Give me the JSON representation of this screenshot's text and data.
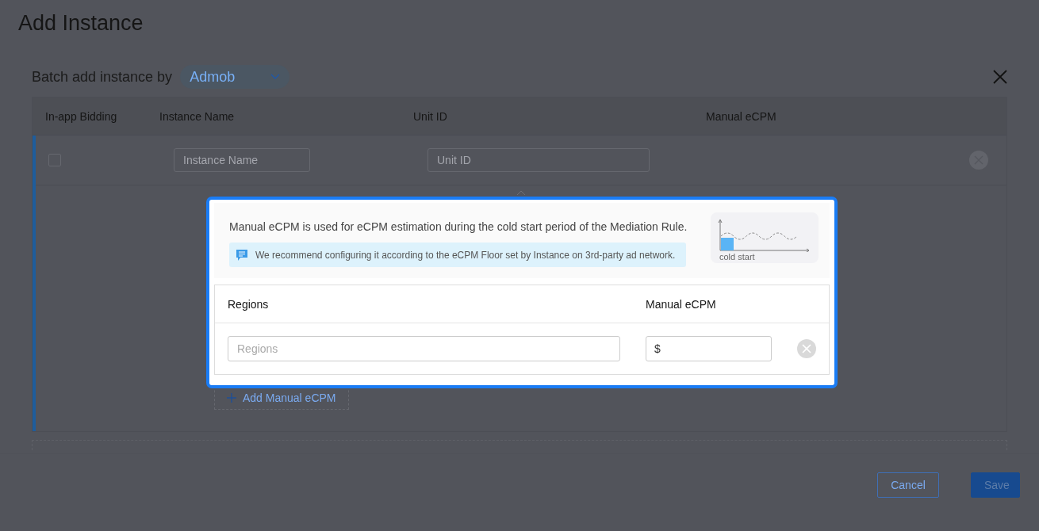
{
  "page": {
    "title": "Add Instance"
  },
  "batch": {
    "label": "Batch add instance by",
    "network": "Admob"
  },
  "table": {
    "columns": [
      "In-app Bidding",
      "Instance Name",
      "Unit ID",
      "Manual eCPM"
    ],
    "rows": [
      {
        "bidding_checked": false,
        "instance_name": {
          "placeholder": "Instance Name"
        },
        "unit_id": {
          "placeholder": "Unit ID"
        }
      }
    ]
  },
  "add_button": "Add Manual eCPM",
  "popover": {
    "description": "Manual eCPM is used for eCPM estimation during the cold start period of the Mediation Rule.",
    "tip": "We recommend configuring it according to the eCPM Floor set by Instance on 3rd-party ad network.",
    "chart_caption": "cold start",
    "columns": [
      "Regions",
      "Manual eCPM"
    ],
    "rows": [
      {
        "regions": {
          "placeholder": "Regions"
        },
        "currency": "$"
      }
    ]
  },
  "footer": {
    "buttons": [
      {
        "label": "Cancel",
        "kind": "secondary"
      },
      {
        "label": "Save",
        "kind": "primary"
      }
    ]
  }
}
